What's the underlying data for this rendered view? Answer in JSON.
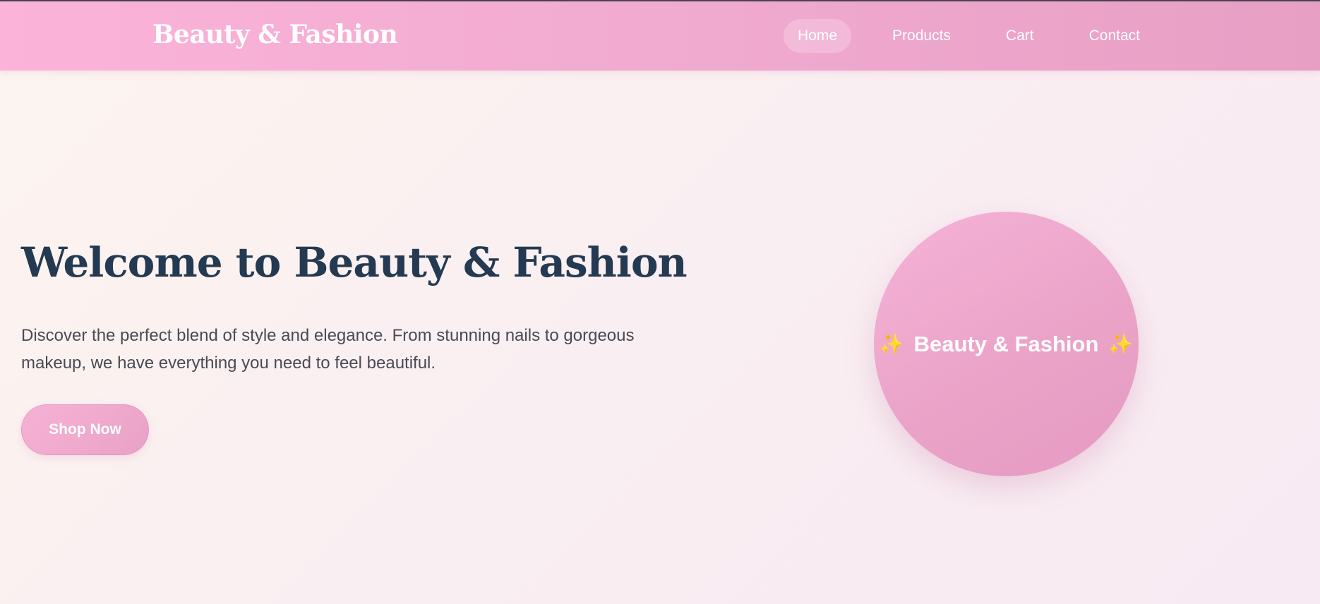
{
  "header": {
    "logo": "Beauty & Fashion",
    "nav": [
      {
        "label": "Home",
        "active": true
      },
      {
        "label": "Products"
      },
      {
        "label": "Cart"
      },
      {
        "label": "Contact"
      }
    ]
  },
  "hero": {
    "title": "Welcome to Beauty & Fashion",
    "description": "Discover the perfect blend of style and elegance. From stunning nails to gorgeous makeup, we have everything you need to feel beautiful.",
    "cta_label": "Shop Now",
    "badge_label": "Beauty & Fashion",
    "badge_icon": "sparkles-icon"
  },
  "colors": {
    "header_pink": "#f0a9cf",
    "title_navy": "#243a52",
    "accent_pink": "#eea8cd"
  }
}
